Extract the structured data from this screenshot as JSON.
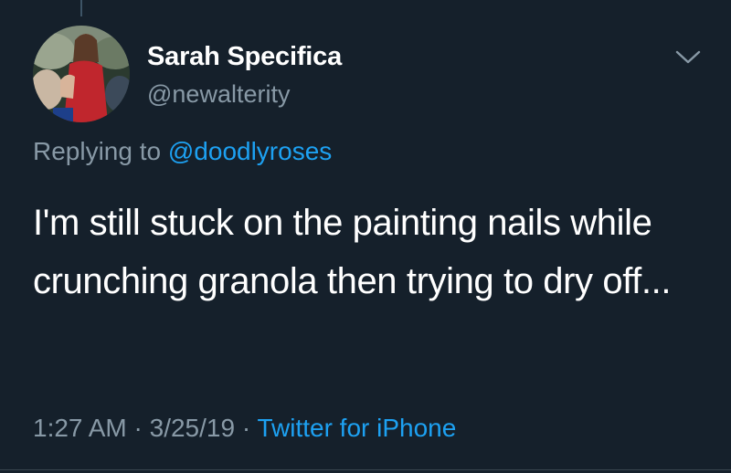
{
  "tweet": {
    "author_name": "Sarah Specifica",
    "author_handle": "@newalterity",
    "reply_prefix": "Replying to",
    "reply_to_handle": "@doodlyroses",
    "text": "I'm still stuck on the painting nails while crunching granola then trying to dry off...",
    "time": "1:27 AM",
    "separator": "·",
    "date": "3/25/19",
    "source": "Twitter for iPhone"
  },
  "icons": {
    "menu": "chevron-down-icon",
    "avatar": "avatar-photo"
  },
  "colors": {
    "background": "#15202b",
    "primary_text": "#ffffff",
    "secondary_text": "#8899a6",
    "link": "#1da1f2"
  }
}
